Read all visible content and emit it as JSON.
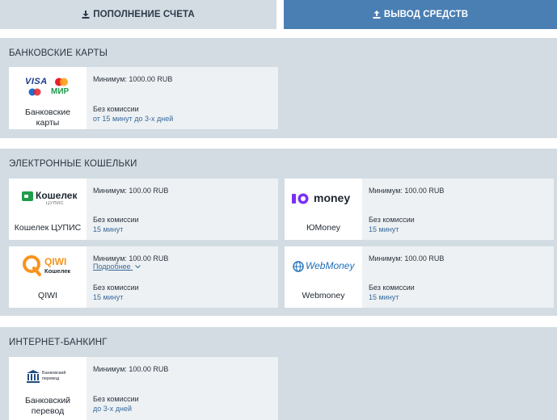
{
  "tabs": {
    "deposit_label": "ПОПОЛНЕНИЕ СЧЕТА",
    "withdraw_label": "ВЫВОД СРЕДСТВ",
    "active": "withdraw"
  },
  "sections": {
    "bank_cards": {
      "title": "БАНКОВСКИЕ КАРТЫ",
      "items": [
        {
          "name": "Банковские карты",
          "min": "Минимум: 1000.00 RUB",
          "fee": "Без комиссии",
          "time": "от 15 минут до 3-х дней",
          "logo_text": [
            "VISA",
            "МИР"
          ]
        }
      ]
    },
    "ewallets": {
      "title": "ЭЛЕКТРОННЫЕ КОШЕЛЬКИ",
      "items": [
        {
          "name": "Кошелек ЦУПИС",
          "min": "Минимум: 100.00 RUB",
          "fee": "Без комиссии",
          "time": "15 минут",
          "logo_text": [
            "Кошелек",
            "ЦУПИС"
          ]
        },
        {
          "name": "ЮMoney",
          "min": "Минимум: 100.00 RUB",
          "fee": "Без комиссии",
          "time": "15 минут",
          "logo_text": [
            "money"
          ]
        },
        {
          "name": "QIWI",
          "min": "Минимум: 100.00 RUB",
          "more": "Подробнее",
          "fee": "Без комиссии",
          "time": "15 минут",
          "logo_text": [
            "QIWI",
            "Кошелек"
          ]
        },
        {
          "name": "Webmoney",
          "min": "Минимум: 100.00 RUB",
          "fee": "Без комиссии",
          "time": "15 минут",
          "logo_text": [
            "WebMoney"
          ]
        }
      ]
    },
    "internet_banking": {
      "title": "ИНТЕРНЕТ-БАНКИНГ",
      "items": [
        {
          "name": "Банковский перевод",
          "min": "Минимум: 100.00 RUB",
          "fee": "Без комиссии",
          "time": "до 3-х дней",
          "logo_text": [
            "Банковский",
            "перевод"
          ]
        }
      ]
    }
  },
  "colors": {
    "active_tab": "#4a7fb4",
    "section_bg": "#d2dce2",
    "link": "#3a6a9c",
    "qiwi_orange": "#f7941e",
    "yoomoney_purple": "#7b2ff7",
    "cupis_green": "#1f9e4a",
    "webmoney_blue": "#1f6fb8"
  }
}
